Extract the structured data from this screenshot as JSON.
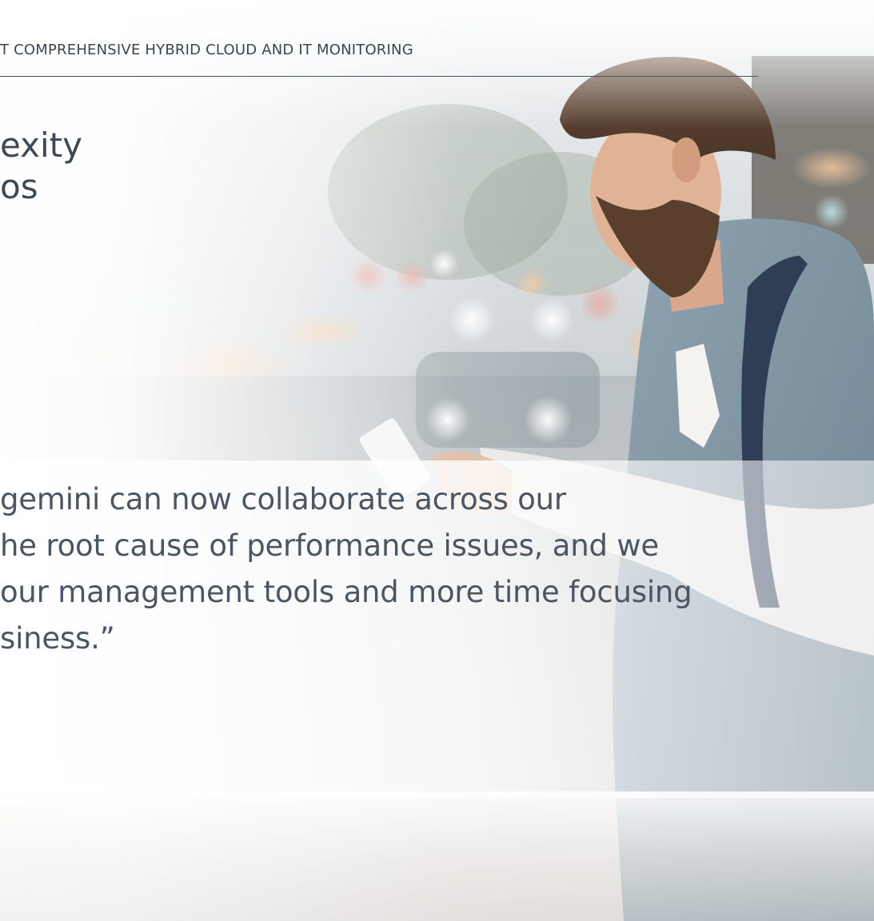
{
  "header": {
    "label": "T COMPREHENSIVE HYBRID CLOUD AND IT MONITORING"
  },
  "headline": {
    "lines": [
      "exity",
      "os"
    ]
  },
  "quote": {
    "lines": [
      "gemini can now collaborate across our",
      "he root cause of performance issues, and we",
      "our management tools and more time focusing",
      "siness.”"
    ]
  },
  "colors": {
    "text_dark": "#3d4a55",
    "rule": "#4a535c",
    "jacket": "#7f95a3"
  },
  "icons": {
    "photo": "man-with-smartphone-photo"
  }
}
